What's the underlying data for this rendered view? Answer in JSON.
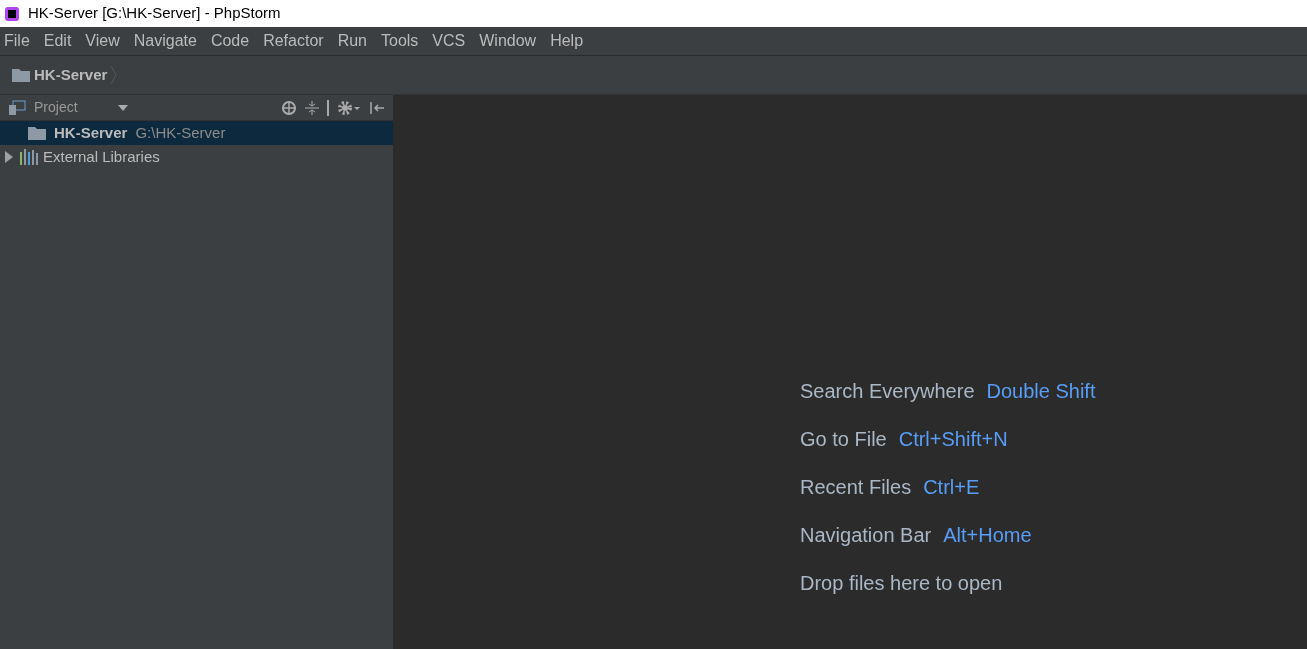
{
  "window": {
    "title": "HK-Server [G:\\HK-Server] - PhpStorm"
  },
  "menu": [
    "File",
    "Edit",
    "View",
    "Navigate",
    "Code",
    "Refactor",
    "Run",
    "Tools",
    "VCS",
    "Window",
    "Help"
  ],
  "breadcrumb": [
    "HK-Server"
  ],
  "project_panel": {
    "title": "Project",
    "tree": [
      {
        "kind": "folder",
        "label": "HK-Server",
        "path": "G:\\HK-Server",
        "selected": true
      },
      {
        "kind": "libraries",
        "label": "External Libraries",
        "selected": false,
        "expanded": false
      }
    ]
  },
  "editor_hints": [
    {
      "action": "Search Everywhere",
      "shortcut": "Double Shift"
    },
    {
      "action": "Go to File",
      "shortcut": "Ctrl+Shift+N"
    },
    {
      "action": "Recent Files",
      "shortcut": "Ctrl+E"
    },
    {
      "action": "Navigation Bar",
      "shortcut": "Alt+Home"
    },
    {
      "action": "Drop files here to open"
    }
  ]
}
